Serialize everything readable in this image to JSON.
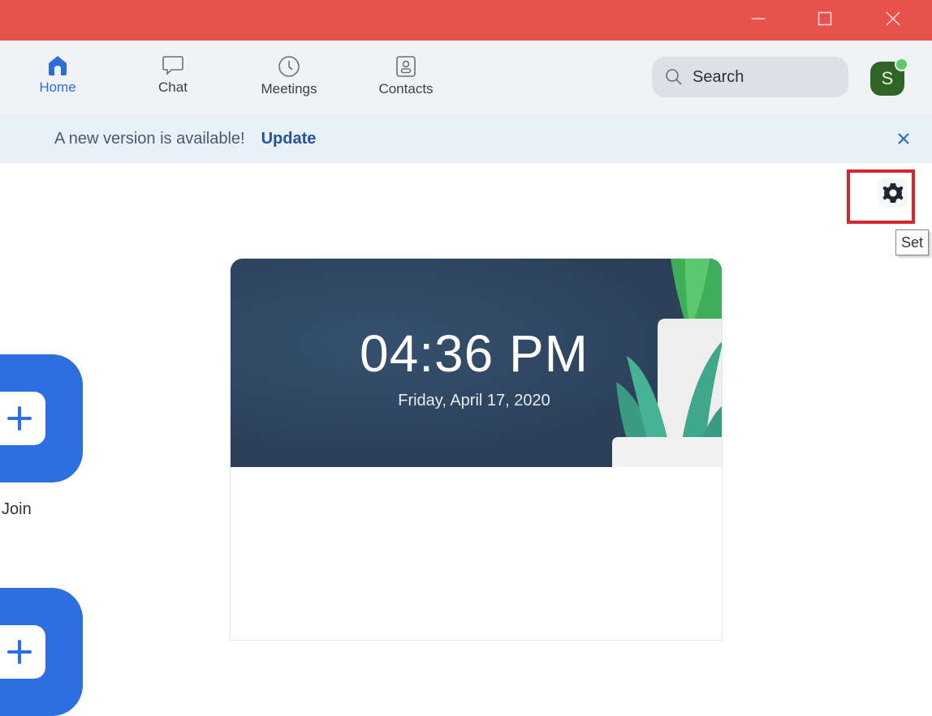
{
  "window": {
    "controls": {
      "minimize_icon": "minimize-icon",
      "maximize_icon": "maximize-icon",
      "close_icon": "close-icon"
    },
    "titlebar_color": "#e9524c"
  },
  "nav": {
    "tabs": [
      {
        "label": "Home",
        "icon": "home-icon",
        "active": true
      },
      {
        "label": "Chat",
        "icon": "chat-bubble-icon",
        "active": false
      },
      {
        "label": "Meetings",
        "icon": "clock-icon",
        "active": false
      },
      {
        "label": "Contacts",
        "icon": "contact-card-icon",
        "active": false
      }
    ],
    "search": {
      "placeholder": "Search",
      "icon": "search-icon"
    },
    "avatar": {
      "initial": "S",
      "status": "online",
      "color": "#2f6424"
    }
  },
  "banner": {
    "message": "A new version is available!",
    "action_label": "Update",
    "close_icon": "close-icon"
  },
  "settings": {
    "icon": "gear-icon",
    "tooltip": "Set",
    "highlight_color": "#d2272d"
  },
  "actions": [
    {
      "label": "Join",
      "icon": "plus-icon"
    },
    {
      "label": "",
      "icon": "plus-icon"
    }
  ],
  "card": {
    "time": "04:36 PM",
    "date": "Friday, April 17, 2020"
  },
  "accent_color": "#2d6fe0"
}
